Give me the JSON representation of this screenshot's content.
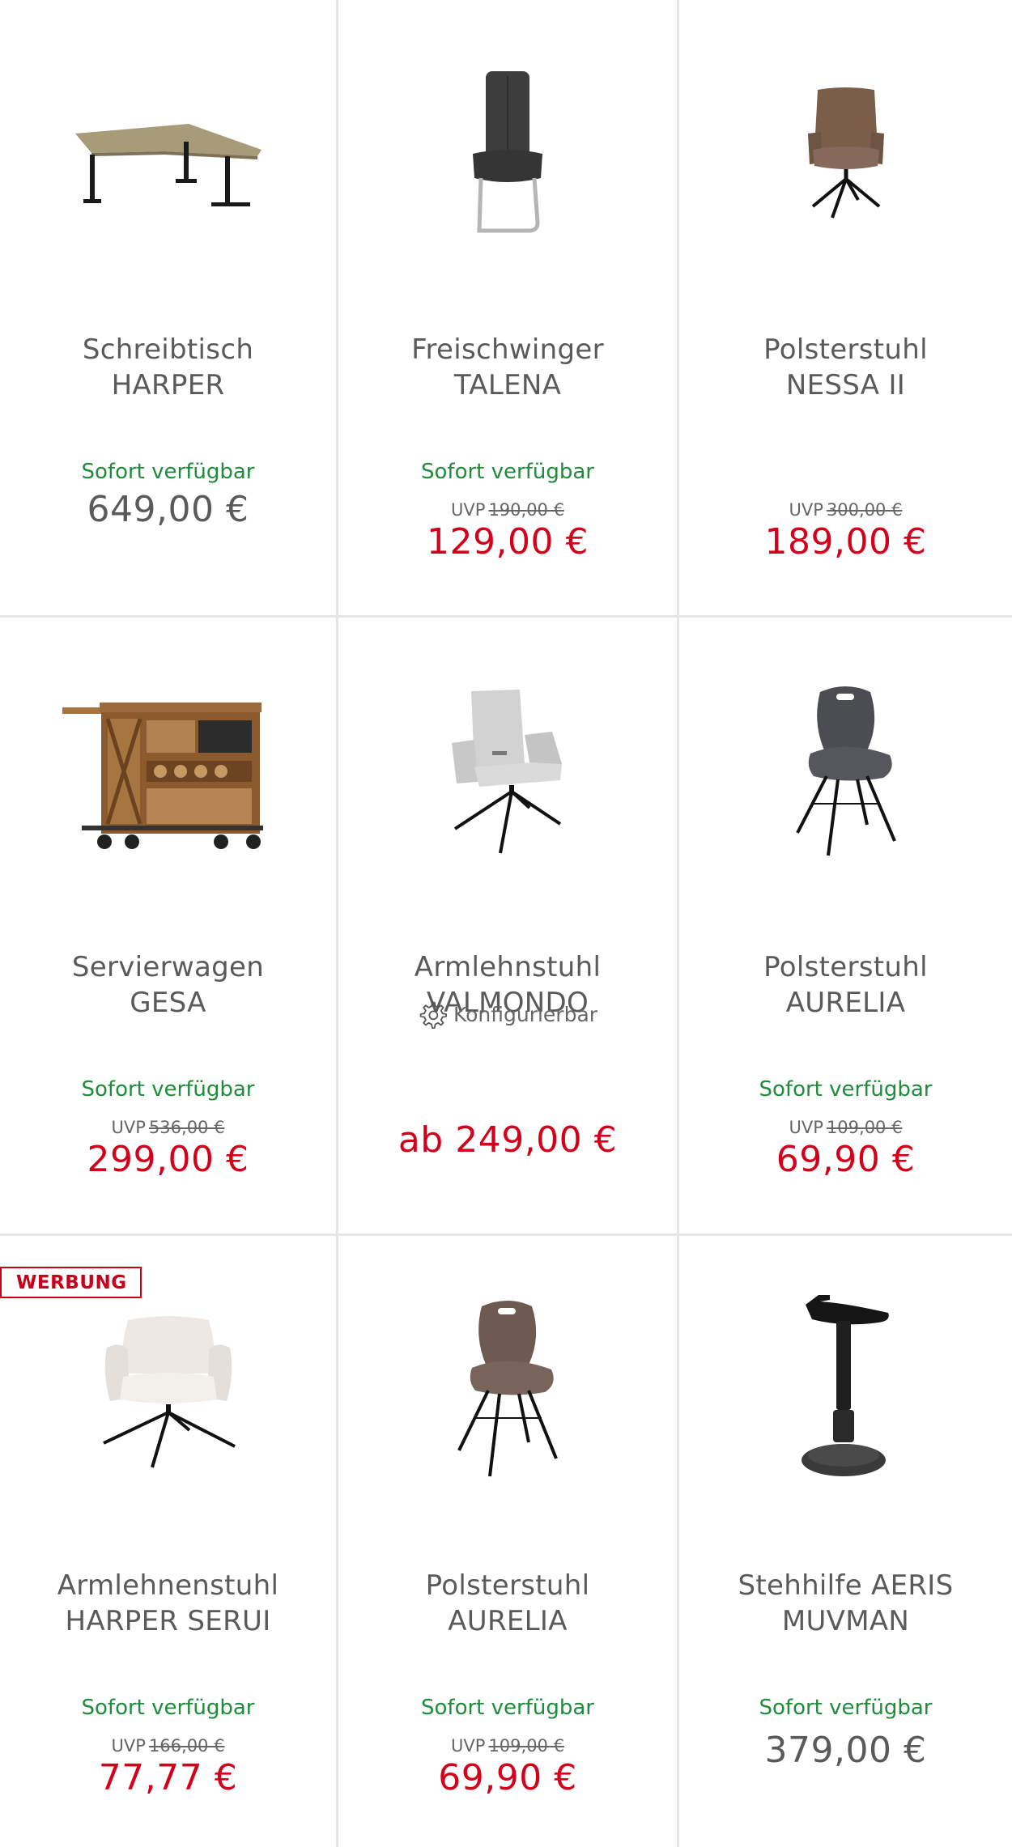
{
  "products": [
    {
      "name1": "Schreibtisch",
      "name2": "HARPER",
      "availability": "Sofort verfügbar",
      "uvp_label": "",
      "uvp_old": "",
      "price": "649,00 €",
      "icon": "desk-image"
    },
    {
      "name1": "Freischwinger",
      "name2": "TALENA",
      "availability": "Sofort verfügbar",
      "uvp_label": "UVP",
      "uvp_old": "190,00 €",
      "price": "129,00 €",
      "icon": "cantilever-chair-image"
    },
    {
      "name1": "Polsterstuhl",
      "name2": "NESSA II",
      "availability": "",
      "uvp_label": "UVP",
      "uvp_old": "300,00 €",
      "price": "189,00 €",
      "icon": "upholstered-chair-image"
    },
    {
      "name1": "Servierwagen",
      "name2": "GESA",
      "availability": "Sofort verfügbar",
      "uvp_label": "UVP",
      "uvp_old": "536,00 €",
      "price": "299,00 €",
      "icon": "serving-cart-image"
    },
    {
      "name1": "Armlehnstuhl",
      "name2": "VALMONDO",
      "configurable": "Konfigurierbar",
      "availability": "",
      "uvp_label": "",
      "uvp_old": "",
      "price": "ab 249,00 €",
      "icon": "armchair-image"
    },
    {
      "name1": "Polsterstuhl",
      "name2": "AURELIA",
      "availability": "Sofort verfügbar",
      "uvp_label": "UVP",
      "uvp_old": "109,00 €",
      "price": "69,90 €",
      "icon": "shell-chair-image"
    },
    {
      "name1": "Armlehnenstuhl",
      "name2": "HARPER SERUI",
      "badge": "WERBUNG",
      "availability": "Sofort verfügbar",
      "uvp_label": "UVP",
      "uvp_old": "166,00 €",
      "price": "77,77 €",
      "icon": "lounge-chair-image"
    },
    {
      "name1": "Polsterstuhl",
      "name2": "AURELIA",
      "availability": "Sofort verfügbar",
      "uvp_label": "UVP",
      "uvp_old": "109,00 €",
      "price": "69,90 €",
      "icon": "shell-chair-image"
    },
    {
      "name1": "Stehhilfe AERIS",
      "name2": "MUVMAN",
      "availability": "Sofort verfügbar",
      "uvp_label": "",
      "uvp_old": "",
      "price": "379,00 €",
      "icon": "standing-stool-image"
    }
  ],
  "colors": {
    "price_sale": "#d3001b",
    "available": "#1f8c3c",
    "badge": "#c8001a"
  }
}
